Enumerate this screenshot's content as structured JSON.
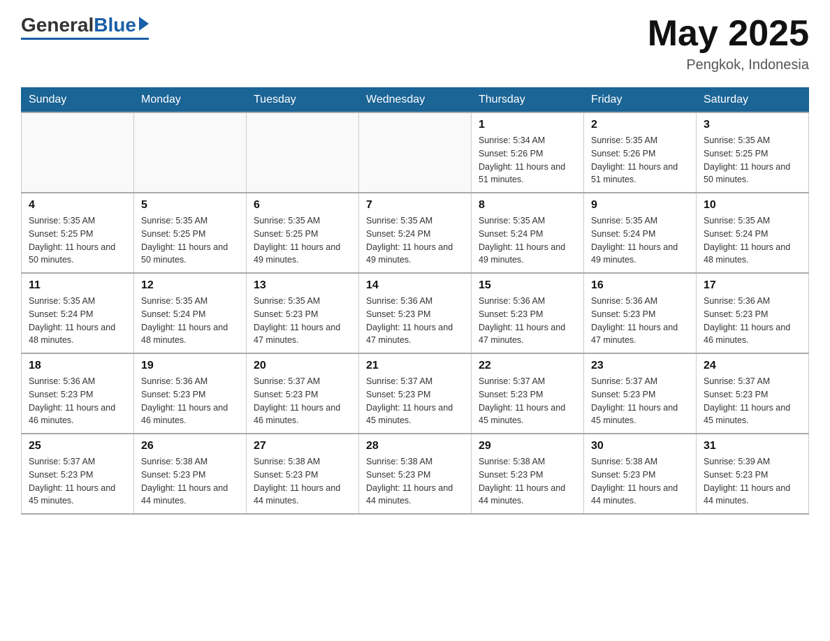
{
  "header": {
    "logo_general": "General",
    "logo_blue": "Blue",
    "month_year": "May 2025",
    "location": "Pengkok, Indonesia"
  },
  "days_of_week": [
    "Sunday",
    "Monday",
    "Tuesday",
    "Wednesday",
    "Thursday",
    "Friday",
    "Saturday"
  ],
  "weeks": [
    [
      {
        "day": "",
        "info": ""
      },
      {
        "day": "",
        "info": ""
      },
      {
        "day": "",
        "info": ""
      },
      {
        "day": "",
        "info": ""
      },
      {
        "day": "1",
        "info": "Sunrise: 5:34 AM\nSunset: 5:26 PM\nDaylight: 11 hours and 51 minutes."
      },
      {
        "day": "2",
        "info": "Sunrise: 5:35 AM\nSunset: 5:26 PM\nDaylight: 11 hours and 51 minutes."
      },
      {
        "day": "3",
        "info": "Sunrise: 5:35 AM\nSunset: 5:25 PM\nDaylight: 11 hours and 50 minutes."
      }
    ],
    [
      {
        "day": "4",
        "info": "Sunrise: 5:35 AM\nSunset: 5:25 PM\nDaylight: 11 hours and 50 minutes."
      },
      {
        "day": "5",
        "info": "Sunrise: 5:35 AM\nSunset: 5:25 PM\nDaylight: 11 hours and 50 minutes."
      },
      {
        "day": "6",
        "info": "Sunrise: 5:35 AM\nSunset: 5:25 PM\nDaylight: 11 hours and 49 minutes."
      },
      {
        "day": "7",
        "info": "Sunrise: 5:35 AM\nSunset: 5:24 PM\nDaylight: 11 hours and 49 minutes."
      },
      {
        "day": "8",
        "info": "Sunrise: 5:35 AM\nSunset: 5:24 PM\nDaylight: 11 hours and 49 minutes."
      },
      {
        "day": "9",
        "info": "Sunrise: 5:35 AM\nSunset: 5:24 PM\nDaylight: 11 hours and 49 minutes."
      },
      {
        "day": "10",
        "info": "Sunrise: 5:35 AM\nSunset: 5:24 PM\nDaylight: 11 hours and 48 minutes."
      }
    ],
    [
      {
        "day": "11",
        "info": "Sunrise: 5:35 AM\nSunset: 5:24 PM\nDaylight: 11 hours and 48 minutes."
      },
      {
        "day": "12",
        "info": "Sunrise: 5:35 AM\nSunset: 5:24 PM\nDaylight: 11 hours and 48 minutes."
      },
      {
        "day": "13",
        "info": "Sunrise: 5:35 AM\nSunset: 5:23 PM\nDaylight: 11 hours and 47 minutes."
      },
      {
        "day": "14",
        "info": "Sunrise: 5:36 AM\nSunset: 5:23 PM\nDaylight: 11 hours and 47 minutes."
      },
      {
        "day": "15",
        "info": "Sunrise: 5:36 AM\nSunset: 5:23 PM\nDaylight: 11 hours and 47 minutes."
      },
      {
        "day": "16",
        "info": "Sunrise: 5:36 AM\nSunset: 5:23 PM\nDaylight: 11 hours and 47 minutes."
      },
      {
        "day": "17",
        "info": "Sunrise: 5:36 AM\nSunset: 5:23 PM\nDaylight: 11 hours and 46 minutes."
      }
    ],
    [
      {
        "day": "18",
        "info": "Sunrise: 5:36 AM\nSunset: 5:23 PM\nDaylight: 11 hours and 46 minutes."
      },
      {
        "day": "19",
        "info": "Sunrise: 5:36 AM\nSunset: 5:23 PM\nDaylight: 11 hours and 46 minutes."
      },
      {
        "day": "20",
        "info": "Sunrise: 5:37 AM\nSunset: 5:23 PM\nDaylight: 11 hours and 46 minutes."
      },
      {
        "day": "21",
        "info": "Sunrise: 5:37 AM\nSunset: 5:23 PM\nDaylight: 11 hours and 45 minutes."
      },
      {
        "day": "22",
        "info": "Sunrise: 5:37 AM\nSunset: 5:23 PM\nDaylight: 11 hours and 45 minutes."
      },
      {
        "day": "23",
        "info": "Sunrise: 5:37 AM\nSunset: 5:23 PM\nDaylight: 11 hours and 45 minutes."
      },
      {
        "day": "24",
        "info": "Sunrise: 5:37 AM\nSunset: 5:23 PM\nDaylight: 11 hours and 45 minutes."
      }
    ],
    [
      {
        "day": "25",
        "info": "Sunrise: 5:37 AM\nSunset: 5:23 PM\nDaylight: 11 hours and 45 minutes."
      },
      {
        "day": "26",
        "info": "Sunrise: 5:38 AM\nSunset: 5:23 PM\nDaylight: 11 hours and 44 minutes."
      },
      {
        "day": "27",
        "info": "Sunrise: 5:38 AM\nSunset: 5:23 PM\nDaylight: 11 hours and 44 minutes."
      },
      {
        "day": "28",
        "info": "Sunrise: 5:38 AM\nSunset: 5:23 PM\nDaylight: 11 hours and 44 minutes."
      },
      {
        "day": "29",
        "info": "Sunrise: 5:38 AM\nSunset: 5:23 PM\nDaylight: 11 hours and 44 minutes."
      },
      {
        "day": "30",
        "info": "Sunrise: 5:38 AM\nSunset: 5:23 PM\nDaylight: 11 hours and 44 minutes."
      },
      {
        "day": "31",
        "info": "Sunrise: 5:39 AM\nSunset: 5:23 PM\nDaylight: 11 hours and 44 minutes."
      }
    ]
  ]
}
